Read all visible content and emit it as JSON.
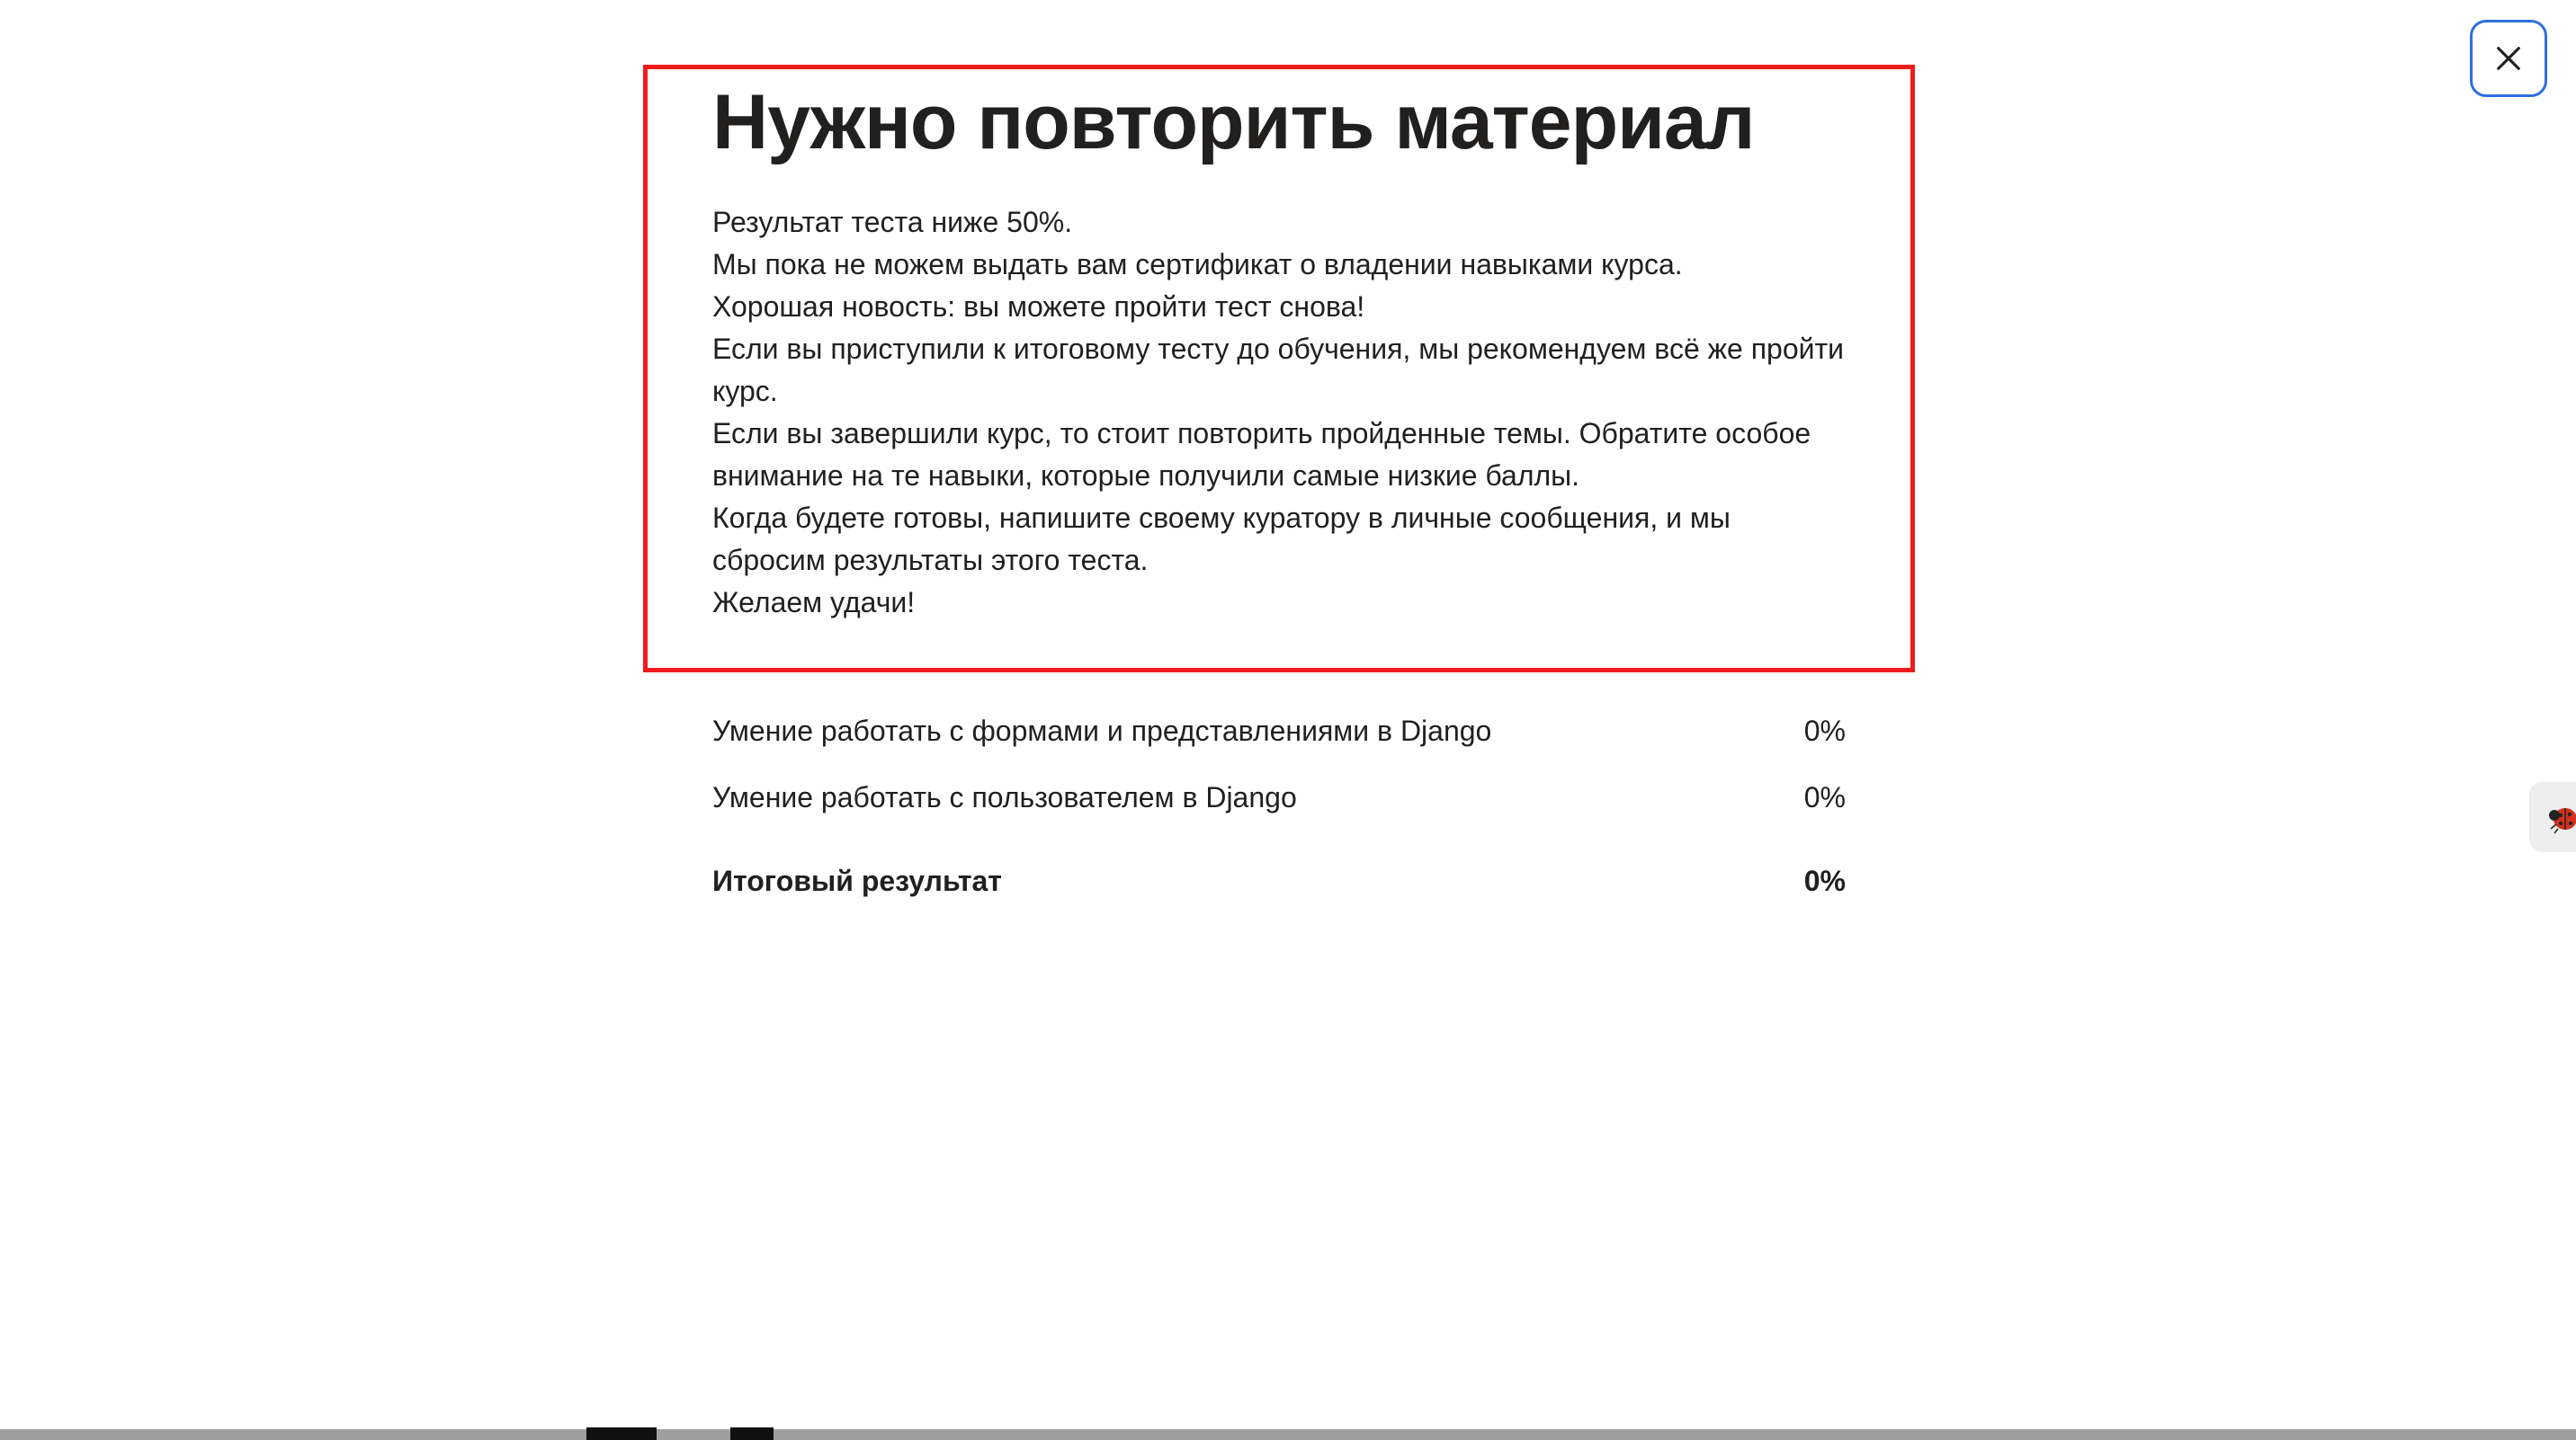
{
  "dialog": {
    "title": "Нужно повторить материал",
    "message_lines": [
      "Результат теста ниже 50%.",
      "Мы пока не можем выдать вам сертификат о владении навыками курса.",
      "Хорошая новость: вы можете пройти тест снова!",
      "Если вы приступили к итоговому тесту до обучения, мы рекомендуем всё же пройти курс.",
      "Если вы завершили курс, то стоит повторить пройденные темы. Обратите особое внимание на те навыки, которые получили самые низкие баллы.",
      "Когда будете готовы, напишите своему куратору в личные сообщения, и мы сбросим результаты этого теста.",
      "Желаем удачи!"
    ],
    "close_icon": "close-icon",
    "highlight_color": "#ee1c1c",
    "close_border_color": "#2f6fe0"
  },
  "results": {
    "skills": [
      {
        "label": "Умение работать с формами и представлениями в Django",
        "value": "0%"
      },
      {
        "label": "Умение работать с пользователем в Django",
        "value": "0%"
      }
    ],
    "total": {
      "label": "Итоговый результат",
      "value": "0%"
    }
  },
  "side_widget": {
    "icon": "ladybug-icon"
  }
}
